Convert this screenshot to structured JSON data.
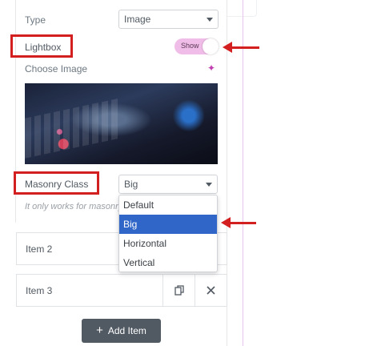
{
  "repeater": {
    "type_label": "Type",
    "type_value": "Image",
    "lightbox_label": "Lightbox",
    "lightbox_toggle_text": "Show",
    "choose_image_label": "Choose Image",
    "ai_icon": "sparkle-icon",
    "masonry_label": "Masonry Class",
    "masonry_value": "Big",
    "masonry_note": "It only works for masonry",
    "masonry_options": [
      "Default",
      "Big",
      "Horizontal",
      "Vertical"
    ],
    "masonry_selected": "Big"
  },
  "items": [
    {
      "title": "Item 2"
    },
    {
      "title": "Item 3",
      "duplicate_icon": "copy-icon",
      "remove_icon": "close-icon"
    }
  ],
  "add_item_label": "Add Item",
  "colors": {
    "highlight": "#d31f1f",
    "toggle_on": "#f0bde8",
    "selected_option": "#3066c7"
  }
}
